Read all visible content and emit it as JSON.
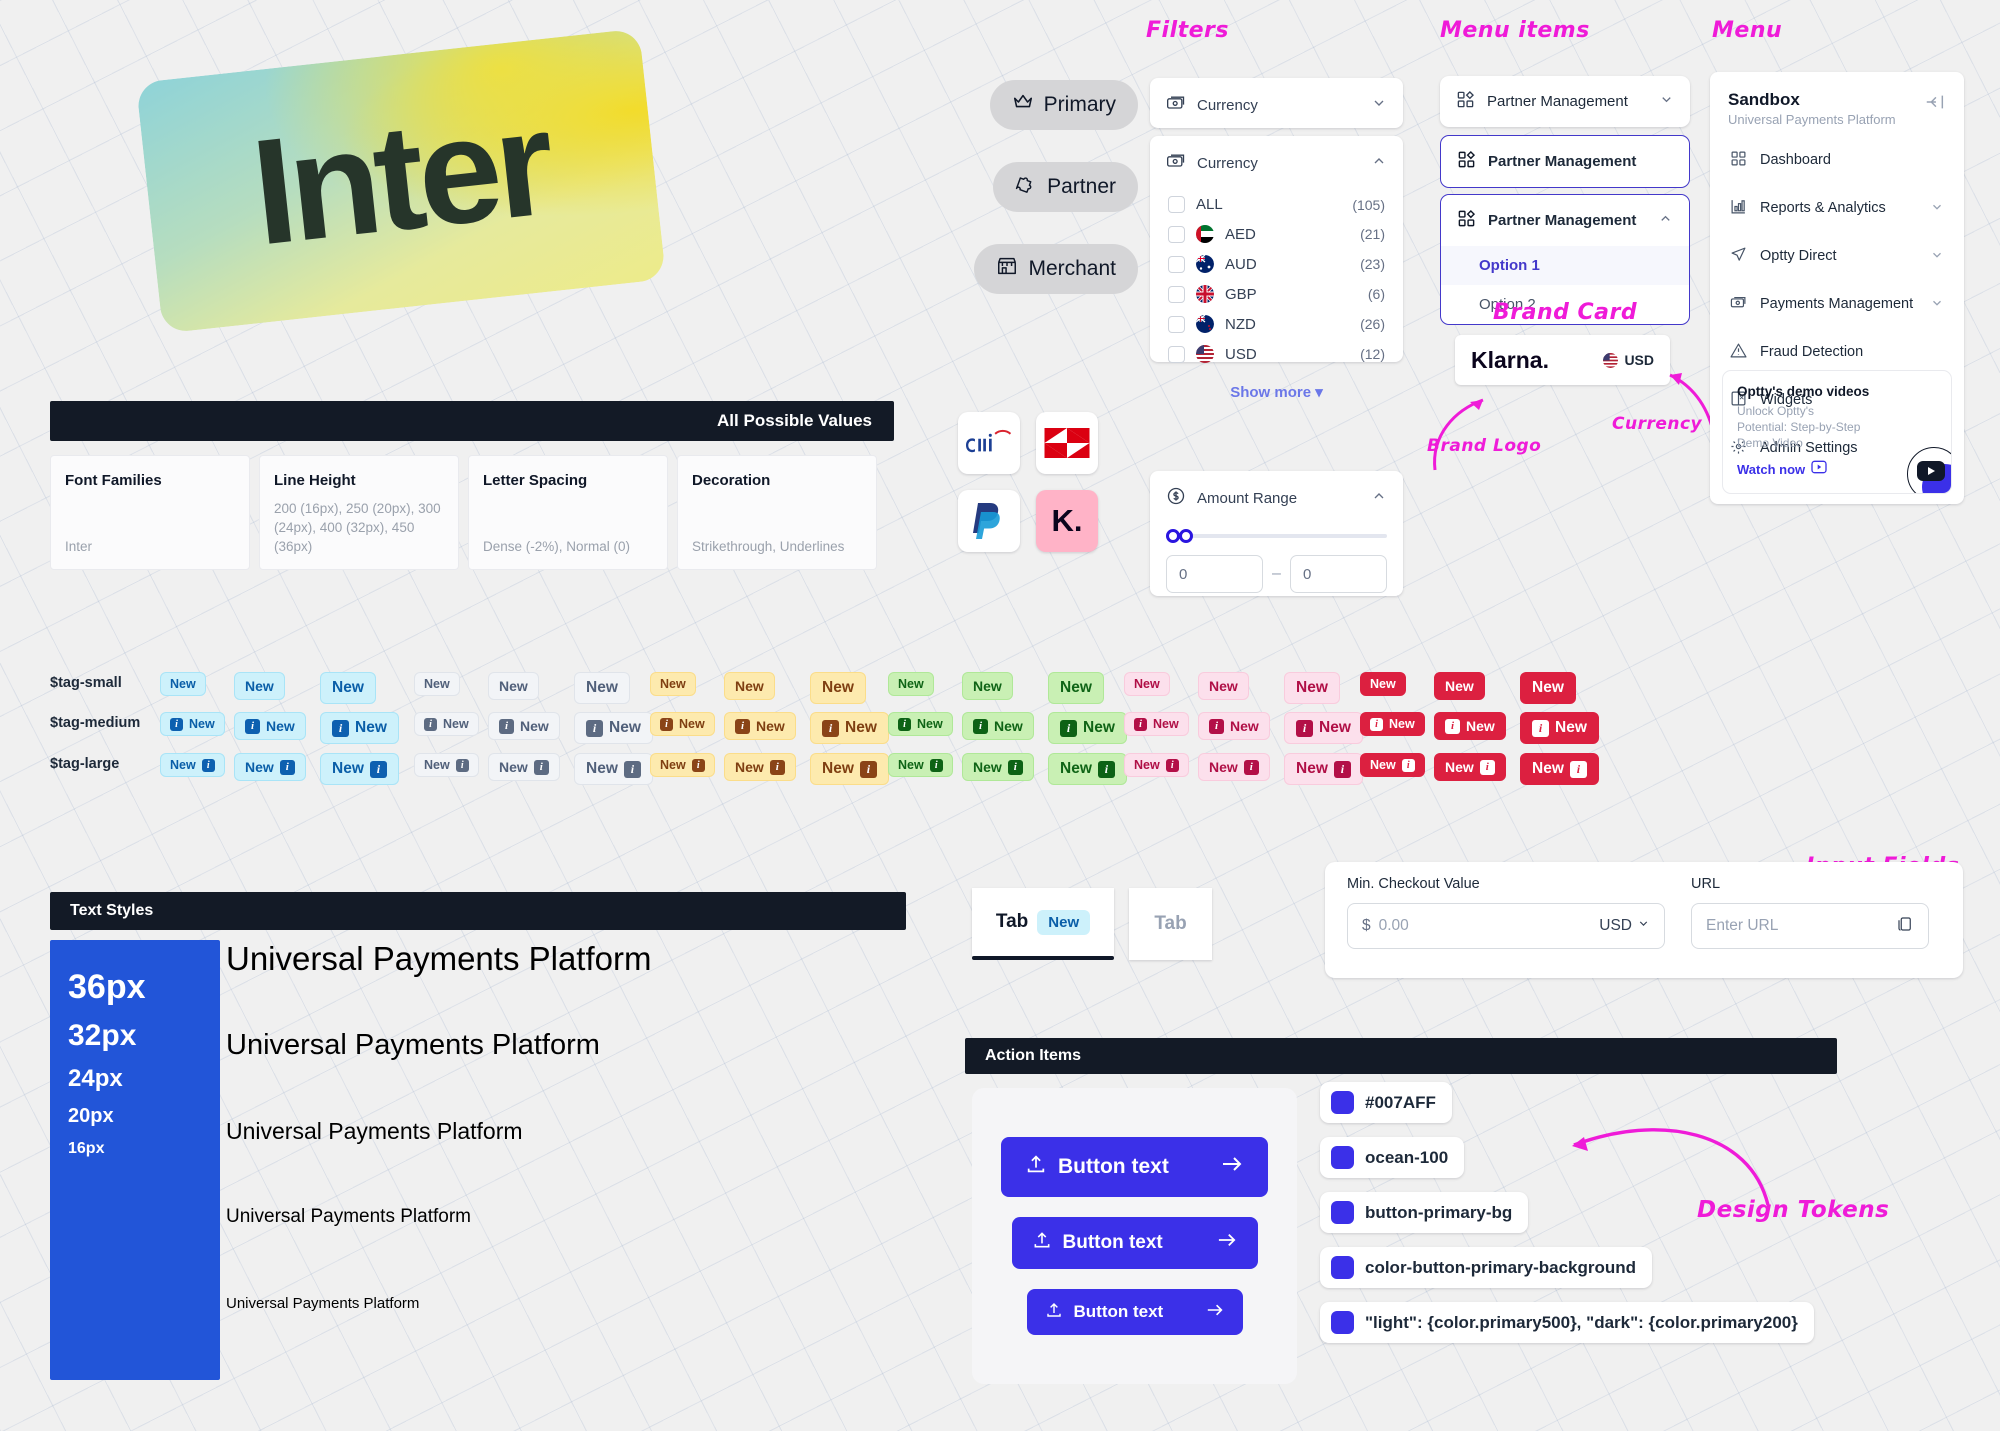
{
  "hero": {
    "font_name": "Inter"
  },
  "values_section": {
    "title": "All Possible Values",
    "cards": [
      {
        "title": "Font Families",
        "value": "Inter"
      },
      {
        "title": "Line Height",
        "value": "200 (16px), 250 (20px), 300 (24px), 400 (32px), 450 (36px)"
      },
      {
        "title": "Letter Spacing",
        "value": "Dense (-2%), Normal (0)"
      },
      {
        "title": "Decoration",
        "value": "Strikethrough, Underlines"
      }
    ]
  },
  "chips": [
    {
      "label": "Primary",
      "icon": "crown-icon"
    },
    {
      "label": "Partner",
      "icon": "puzzle-icon"
    },
    {
      "label": "Merchant",
      "icon": "store-icon"
    }
  ],
  "brand_logos": [
    {
      "name": "citi",
      "label": "citi"
    },
    {
      "name": "hsbc",
      "label": "HSBC"
    },
    {
      "name": "paypal",
      "label": "PayPal"
    },
    {
      "name": "klarna",
      "label": "K."
    }
  ],
  "annotations": {
    "filters": "Filters",
    "menu_items": "Menu items",
    "menu": "Menu",
    "brand_card": "Brand Card",
    "brand_logo": "Brand Logo",
    "currency": "Currency",
    "input_fields": "Input Fields",
    "design_tokens": "Design Tokens"
  },
  "filters": {
    "collapsed": {
      "label": "Currency",
      "icon": "money-icon",
      "chevron": "chevron-down-icon"
    },
    "expanded": {
      "label": "Currency",
      "icon": "money-icon",
      "chevron": "chevron-up-icon",
      "options": [
        {
          "code": "ALL",
          "count": "(105)",
          "flag": "none"
        },
        {
          "code": "AED",
          "count": "(21)",
          "flag": "ae"
        },
        {
          "code": "AUD",
          "count": "(23)",
          "flag": "au"
        },
        {
          "code": "GBP",
          "count": "(6)",
          "flag": "gb"
        },
        {
          "code": "NZD",
          "count": "(26)",
          "flag": "nz"
        },
        {
          "code": "USD",
          "count": "(12)",
          "flag": "us"
        }
      ],
      "show_more": "Show more"
    },
    "amount_range": {
      "label": "Amount Range",
      "icon": "dollar-circle-icon",
      "chevron": "chevron-up-icon",
      "min_value": "0",
      "max_value": "0",
      "separator": "–"
    }
  },
  "menu_items": {
    "default": {
      "label": "Partner Management",
      "icon": "grid-icon",
      "chevron": "chevron-down-icon"
    },
    "selected": {
      "label": "Partner Management",
      "icon": "grid-icon"
    },
    "expanded": {
      "label": "Partner Management",
      "icon": "grid-icon",
      "chevron": "chevron-up-icon",
      "options": [
        {
          "label": "Option 1",
          "active": true
        },
        {
          "label": "Option 2",
          "active": false
        }
      ]
    }
  },
  "brand_card": {
    "brand": "Klarna.",
    "currency": "USD",
    "flag": "us"
  },
  "sidebar": {
    "title": "Sandbox",
    "subtitle": "Universal Payments Platform",
    "collapse_icon": "collapse-left-icon",
    "items": [
      {
        "label": "Dashboard",
        "icon": "dashboard-icon",
        "chevron": ""
      },
      {
        "label": "Reports & Analytics",
        "icon": "bar-chart-icon",
        "chevron": "chevron-down-icon"
      },
      {
        "label": "Optty Direct",
        "icon": "send-icon",
        "chevron": "chevron-down-icon"
      },
      {
        "label": "Payments Management",
        "icon": "money-icon",
        "chevron": "chevron-down-icon"
      },
      {
        "label": "Fraud Detection",
        "icon": "warning-triangle-icon",
        "chevron": ""
      },
      {
        "label": "Widgets",
        "icon": "widgets-icon",
        "chevron": ""
      },
      {
        "label": "Admin Settings",
        "icon": "gear-icon",
        "chevron": ""
      }
    ],
    "promo": {
      "title": "Optty's demo videos",
      "body": "Unlock Optty's Potential: Step-by-Step Demo Video",
      "cta": "Watch now",
      "cta_icon": "play-box-icon"
    }
  },
  "tags": {
    "row_labels": [
      "$tag-small",
      "$tag-medium",
      "$tag-large"
    ],
    "tag_label": "New",
    "info_glyph": "i",
    "palettes": [
      {
        "name": "cyan",
        "bg": "#cdf1fb",
        "fg": "#0a5ea8",
        "icon_bg": "#0d60b0",
        "icon_fg": "#ffffff",
        "border": "#a9e4f7",
        "solid": false
      },
      {
        "name": "grey",
        "bg": "#f2f4f7",
        "fg": "#51607a",
        "icon_bg": "#5d6b82",
        "icon_fg": "#ffffff",
        "border": "#e0e4ea",
        "solid": false
      },
      {
        "name": "amber",
        "bg": "#fdeaae",
        "fg": "#7f3f12",
        "icon_bg": "#8a4417",
        "icon_fg": "#ffffff",
        "border": "#fbdd8a",
        "solid": false
      },
      {
        "name": "green",
        "bg": "#c9f0b4",
        "fg": "#0f6416",
        "icon_bg": "#0d6215",
        "icon_fg": "#ffffff",
        "border": "#b0e898",
        "solid": false
      },
      {
        "name": "pink",
        "bg": "#fce0ec",
        "fg": "#b00f46",
        "icon_bg": "#b30f47",
        "icon_fg": "#ffffff",
        "border": "#f9cbdd",
        "solid": false
      },
      {
        "name": "red",
        "bg": "#dc2040",
        "fg": "#ffffff",
        "icon_bg": "#ffffff",
        "icon_fg": "#dc2040",
        "border": "#dc2040",
        "solid": true
      }
    ]
  },
  "text_styles": {
    "title": "Text Styles",
    "sizes": [
      "36px",
      "32px",
      "24px",
      "20px",
      "16px"
    ],
    "sample": "Universal Payments Platform"
  },
  "tabs": [
    {
      "label": "Tab",
      "badge": "New",
      "active": true
    },
    {
      "label": "Tab",
      "badge": "",
      "active": false
    }
  ],
  "input_fields": {
    "min_checkout": {
      "label": "Min. Checkout Value",
      "prefix": "$",
      "placeholder": "0.00",
      "currency": "USD",
      "chevron": "chevron-down-icon"
    },
    "url": {
      "label": "URL",
      "placeholder": "Enter URL",
      "icon": "copy-icon"
    }
  },
  "action_items": {
    "title": "Action Items",
    "buttons": [
      {
        "label": "Button text",
        "leading_icon": "upload-icon",
        "trailing_icon": "arrow-right-icon",
        "size": "large"
      },
      {
        "label": "Button text",
        "leading_icon": "upload-icon",
        "trailing_icon": "arrow-right-icon",
        "size": "medium"
      },
      {
        "label": "Button text",
        "leading_icon": "upload-icon",
        "trailing_icon": "arrow-right-icon",
        "size": "small"
      }
    ]
  },
  "design_tokens": [
    {
      "label": "#007AFF",
      "color": "#3b30e8"
    },
    {
      "label": "ocean-100",
      "color": "#3b30e8"
    },
    {
      "label": "button-primary-bg",
      "color": "#3b30e8"
    },
    {
      "label": "color-button-primary-background",
      "color": "#3b30e8"
    },
    {
      "label": "\"light\": {color.primary500}, \"dark\": {color.primary200}",
      "color": "#3b30e8"
    }
  ]
}
